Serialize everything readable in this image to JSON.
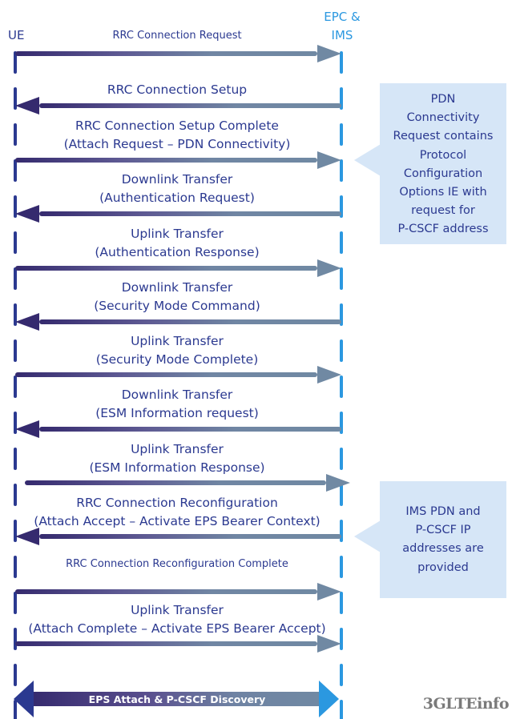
{
  "entities": {
    "ue": {
      "label": "UE"
    },
    "core": {
      "label_lines": [
        "EPC &",
        "IMS"
      ]
    }
  },
  "colors": {
    "text": "#2b3990",
    "ue_lifeline": "#2b3990",
    "core_lifeline": "#2b98e0",
    "arrow_start": "#352a6e",
    "arrow_mid": "#5e5a93",
    "arrow_end": "#7089a3",
    "note_bg": "#d6e6f7",
    "bottom_left_head": "#2b3990",
    "bottom_right_head": "#2b98e0"
  },
  "messages": [
    {
      "id": "rrc-connection-request",
      "direction": "ue-to-core",
      "lines": [
        "RRC Connection Request"
      ],
      "small": true
    },
    {
      "id": "rrc-connection-setup",
      "direction": "core-to-ue",
      "lines": [
        "RRC Connection Setup"
      ]
    },
    {
      "id": "rrc-connection-setup-complete",
      "direction": "ue-to-core",
      "lines": [
        "RRC Connection Setup Complete",
        "(Attach Request – PDN Connectivity)"
      ]
    },
    {
      "id": "downlink-auth-request",
      "direction": "core-to-ue",
      "lines": [
        "Downlink Transfer",
        "(Authentication Request)"
      ]
    },
    {
      "id": "uplink-auth-response",
      "direction": "ue-to-core",
      "lines": [
        "Uplink Transfer",
        "(Authentication Response)"
      ]
    },
    {
      "id": "downlink-security-mode-command",
      "direction": "core-to-ue",
      "lines": [
        "Downlink Transfer",
        "(Security Mode Command)"
      ]
    },
    {
      "id": "uplink-security-mode-complete",
      "direction": "ue-to-core",
      "lines": [
        "Uplink Transfer",
        "(Security Mode Complete)"
      ]
    },
    {
      "id": "downlink-esm-info-request",
      "direction": "core-to-ue",
      "lines": [
        "Downlink Transfer",
        "(ESM Information request)"
      ]
    },
    {
      "id": "uplink-esm-info-response",
      "direction": "ue-to-core",
      "lines": [
        "Uplink Transfer",
        "(ESM Information Response)"
      ]
    },
    {
      "id": "rrc-connection-reconfiguration",
      "direction": "core-to-ue",
      "lines": [
        "RRC Connection Reconfiguration",
        "(Attach Accept – Activate EPS Bearer Context)"
      ]
    },
    {
      "id": "rrc-connection-reconfiguration-complete",
      "direction": "ue-to-core",
      "lines": [
        "RRC Connection Reconfiguration Complete"
      ],
      "small": true
    },
    {
      "id": "uplink-attach-complete",
      "direction": "ue-to-core",
      "lines": [
        "Uplink Transfer",
        "(Attach Complete – Activate EPS Bearer Accept)"
      ]
    }
  ],
  "notes": [
    {
      "id": "pdn-connectivity-note",
      "lines": [
        "PDN",
        "Connectivity",
        "Request contains",
        "Protocol",
        "Configuration",
        "Options IE with",
        "request for",
        "P-CSCF address"
      ]
    },
    {
      "id": "ims-pdn-note",
      "lines": [
        "IMS PDN and",
        "P-CSCF IP",
        "addresses are",
        "provided"
      ]
    }
  ],
  "summary_bar": {
    "label": "EPS Attach & P-CSCF Discovery"
  },
  "watermark": {
    "text": "␹3GLTEinfo"
  }
}
